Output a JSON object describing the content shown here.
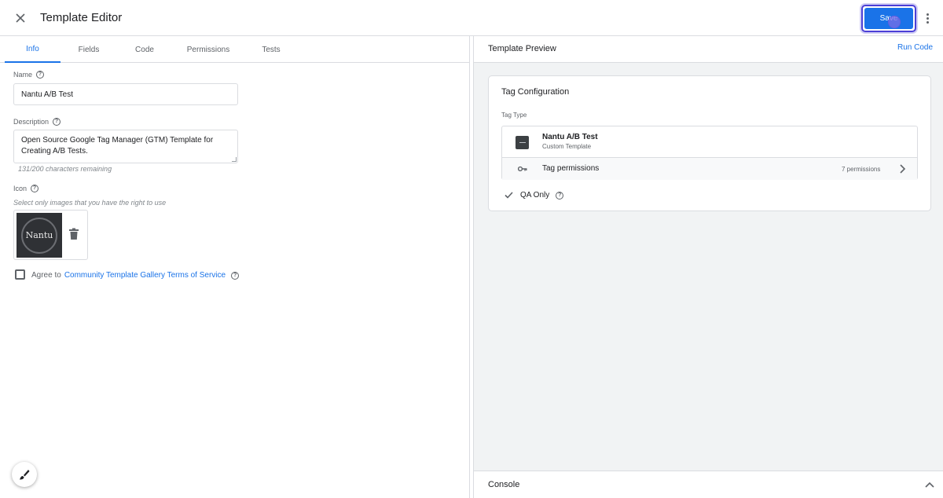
{
  "header": {
    "title": "Template Editor",
    "save_label": "Save",
    "close_icon": "close-icon",
    "more_icon": "more-vert-icon"
  },
  "tabs": [
    {
      "label": "Info",
      "active": true
    },
    {
      "label": "Fields",
      "active": false
    },
    {
      "label": "Code",
      "active": false
    },
    {
      "label": "Permissions",
      "active": false
    },
    {
      "label": "Tests",
      "active": false
    }
  ],
  "info": {
    "name_label": "Name",
    "name_value": "Nantu A/B Test",
    "description_label": "Description",
    "description_value": "Open Source Google Tag Manager (GTM) Template for Creating A/B Tests.",
    "char_remaining": "131/200 characters remaining",
    "icon_label": "Icon",
    "icon_hint": "Select only images that you have the right to use",
    "icon_text": "Nantu",
    "agree_prefix": "Agree to",
    "agree_link": "Community Template Gallery Terms of Service"
  },
  "preview": {
    "title": "Template Preview",
    "run_code": "Run Code",
    "card_title": "Tag Configuration",
    "tag_type_label": "Tag Type",
    "tag_name": "Nantu A/B Test",
    "tag_kind": "Custom Template",
    "permissions_label": "Tag permissions",
    "permissions_count": "7 permissions",
    "qa_label": "QA Only",
    "console_label": "Console"
  },
  "colors": {
    "accent": "#1a73e8",
    "focus_ring": "#4b3fd6"
  }
}
